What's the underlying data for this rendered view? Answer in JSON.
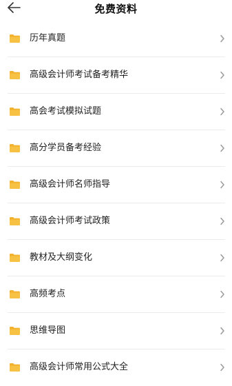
{
  "header": {
    "title": "免费资料",
    "back_icon": "arrow-left-icon"
  },
  "colors": {
    "folder": "#F7C244",
    "folder_tab": "#F2B22E",
    "chevron": "#9a9a9a",
    "divider": "#ebebeb"
  },
  "list": {
    "items": [
      {
        "label": "历年真题"
      },
      {
        "label": "高级会计师考试备考精华"
      },
      {
        "label": "高会考试模拟试题"
      },
      {
        "label": "高分学员备考经验"
      },
      {
        "label": "高级会计师名师指导"
      },
      {
        "label": "高级会计师考试政策"
      },
      {
        "label": "教材及大纲变化"
      },
      {
        "label": "高频考点"
      },
      {
        "label": "思维导图"
      },
      {
        "label": "高级会计师常用公式大全"
      }
    ]
  }
}
